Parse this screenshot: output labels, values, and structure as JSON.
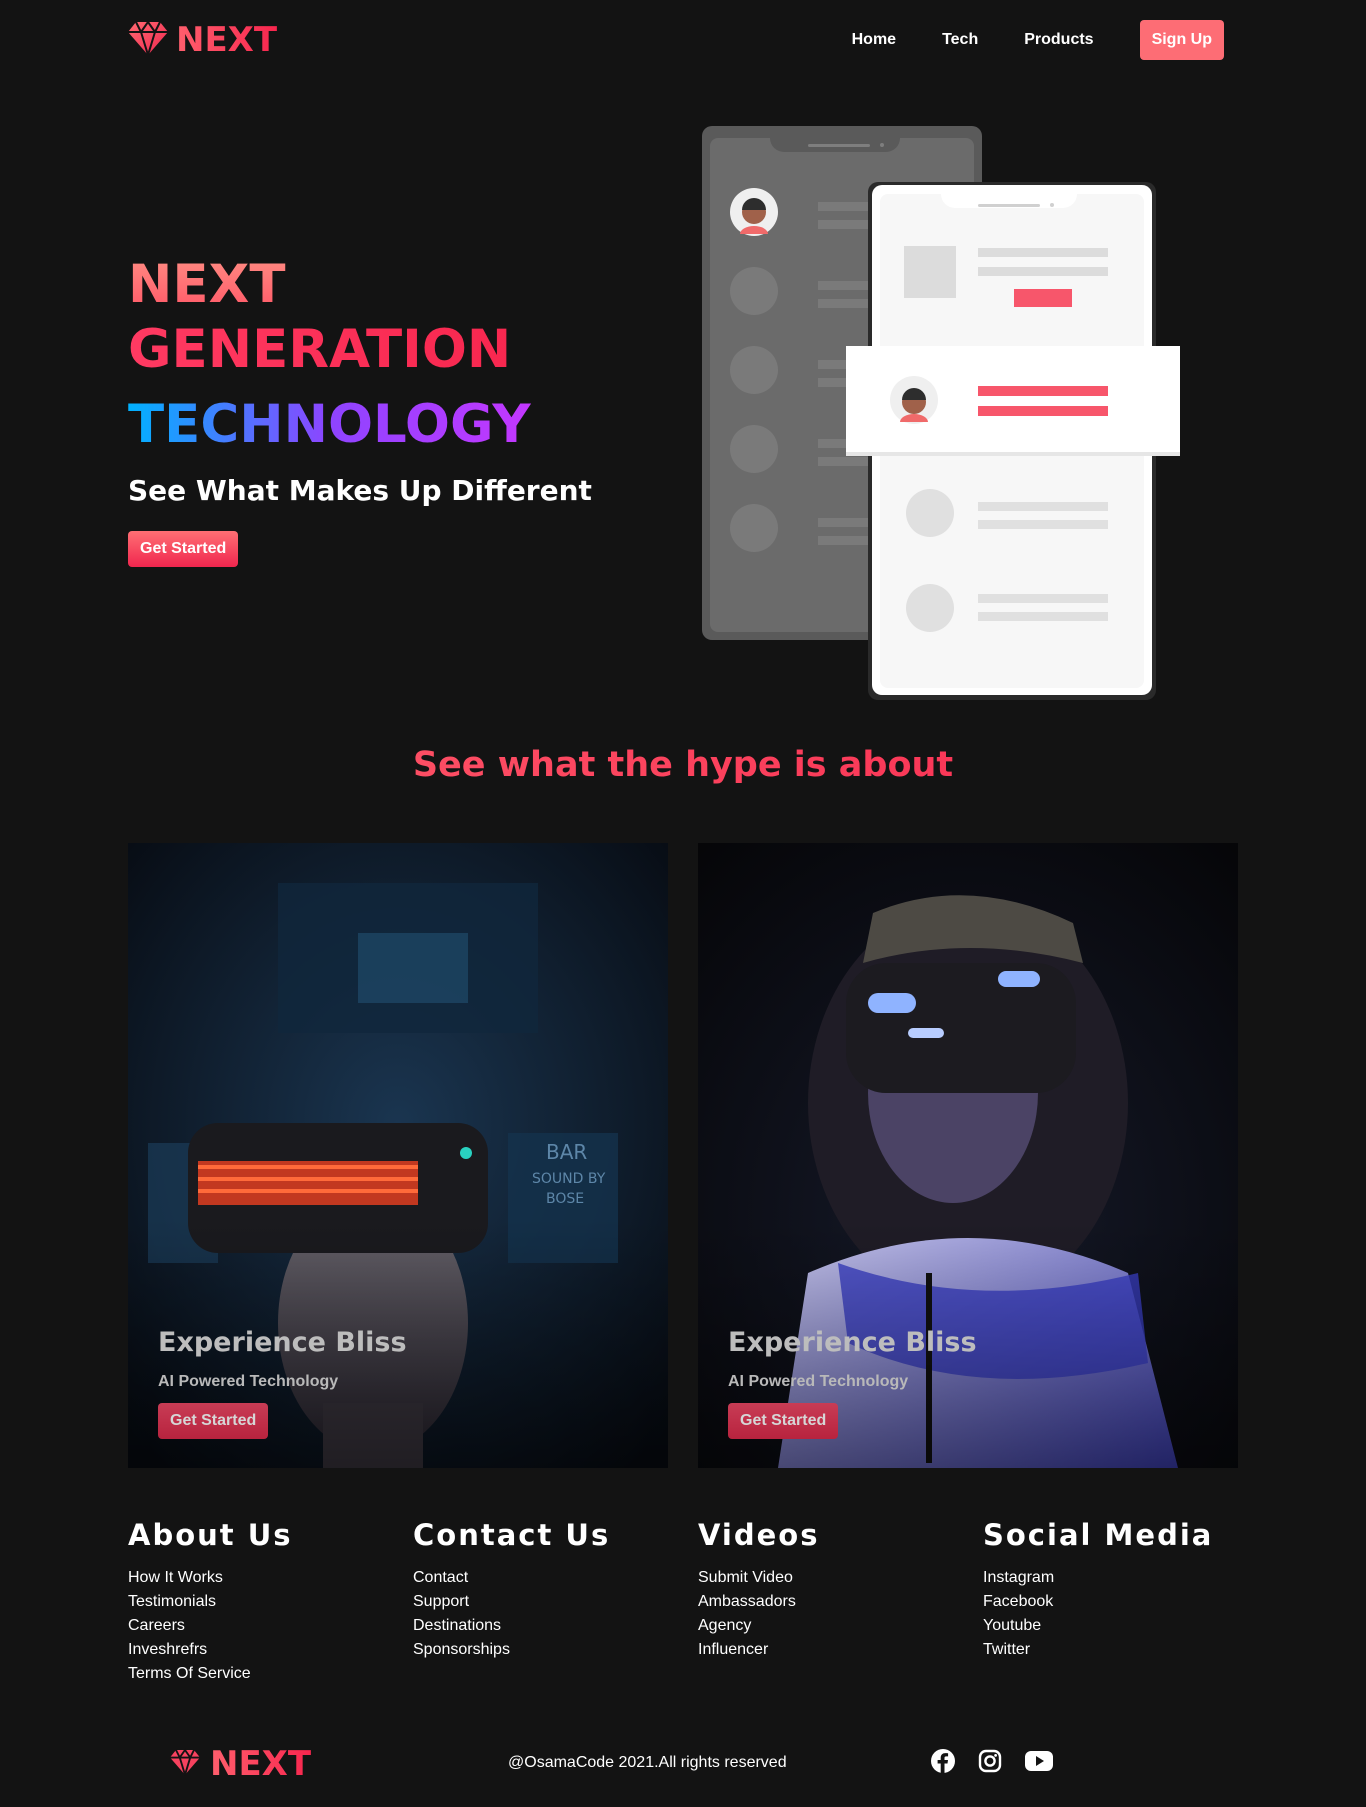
{
  "brand": {
    "name": "NEXT",
    "logo_icon": "diamond-icon",
    "color": "#f7425f"
  },
  "nav": {
    "links": [
      {
        "label": "Home"
      },
      {
        "label": "Tech"
      },
      {
        "label": "Products"
      }
    ],
    "signup_label": "Sign Up"
  },
  "hero": {
    "title_line1": "NEXT",
    "title_line2": "GENERATION",
    "title_line3": "TECHNOLOGY",
    "subtitle": "See What Makes Up Different",
    "cta_label": "Get Started"
  },
  "features": {
    "title": "See what the hype is about",
    "cards": [
      {
        "title": "Experience Bliss",
        "subtitle": "AI Powered Technology",
        "cta_label": "Get Started"
      },
      {
        "title": "Experience Bliss",
        "subtitle": "AI Powered Technology",
        "cta_label": "Get Started"
      }
    ]
  },
  "footer": {
    "columns": [
      {
        "heading": "About Us",
        "links": [
          "How It Works",
          "Testimonials",
          "Careers",
          "Inveshrefrs",
          "Terms Of Service"
        ]
      },
      {
        "heading": "Contact Us",
        "links": [
          "Contact",
          "Support",
          "Destinations",
          "Sponsorships"
        ]
      },
      {
        "heading": "Videos",
        "links": [
          "Submit Video",
          "Ambassadors",
          "Agency",
          "Influencer"
        ]
      },
      {
        "heading": "Social Media",
        "links": [
          "Instagram",
          "Facebook",
          "Youtube",
          "Twitter"
        ]
      }
    ],
    "brand": "NEXT",
    "copyright": "@OsamaCode 2021.All rights reserved",
    "social_icons": [
      "facebook-icon",
      "instagram-icon",
      "youtube-icon"
    ]
  }
}
